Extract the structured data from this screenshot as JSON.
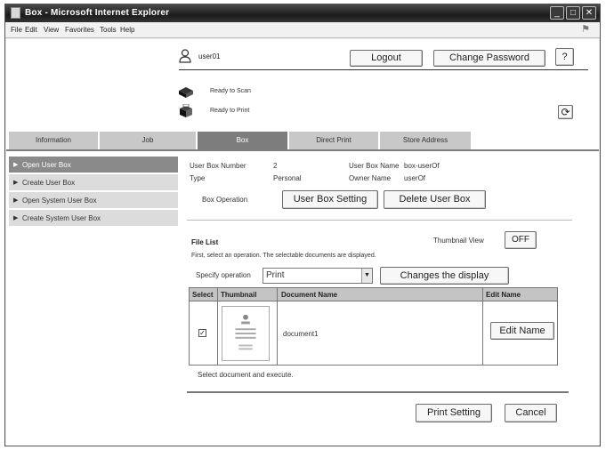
{
  "window": {
    "title": "Box - Microsoft Internet Explorer",
    "controls": {
      "minimize": "_",
      "maximize": "□",
      "close": "✕"
    }
  },
  "menu": [
    "File",
    "Edit",
    "View",
    "Favorites",
    "Tools",
    "Help"
  ],
  "header": {
    "username": "user01",
    "logout_label": "Logout",
    "change_password_label": "Change Password",
    "help_label": "?",
    "scan_status": "Ready to Scan",
    "print_status": "Ready to Print",
    "refresh_label": "⟳"
  },
  "tabs": [
    {
      "label": "Information",
      "active": false
    },
    {
      "label": "Job",
      "active": false
    },
    {
      "label": "Box",
      "active": true
    },
    {
      "label": "Direct Print",
      "active": false
    },
    {
      "label": "Store Address",
      "active": false
    }
  ],
  "sidebar": [
    {
      "label": "Open User Box",
      "active": true
    },
    {
      "label": "Create User Box",
      "active": false
    },
    {
      "label": "Open System User Box",
      "active": false
    },
    {
      "label": "Create System User Box",
      "active": false
    }
  ],
  "box_info": {
    "number_label": "User Box Number",
    "number_value": "2",
    "name_label": "User Box Name",
    "name_value": "box-userOf",
    "type_label": "Type",
    "type_value": "Personal",
    "owner_label": "Owner Name",
    "owner_value": "userOf",
    "operation_label": "Box Operation",
    "setting_button": "User Box Setting",
    "delete_button": "Delete User Box"
  },
  "file_list": {
    "title": "File List",
    "thumbnail_view_label": "Thumbnail View",
    "thumbnail_toggle": "OFF",
    "instruction": "First, select an operation. The selectable documents are displayed.",
    "specify_label": "Specify operation",
    "operation_value": "Print",
    "change_display_button": "Changes the display",
    "columns": [
      "Select",
      "Thumbnail",
      "Document Name",
      "Edit Name"
    ],
    "rows": [
      {
        "checked": "✓",
        "name": "document1",
        "edit_button": "Edit Name"
      }
    ],
    "footer_note": "Select document and execute."
  },
  "actions": {
    "print_setting": "Print Setting",
    "cancel": "Cancel"
  }
}
